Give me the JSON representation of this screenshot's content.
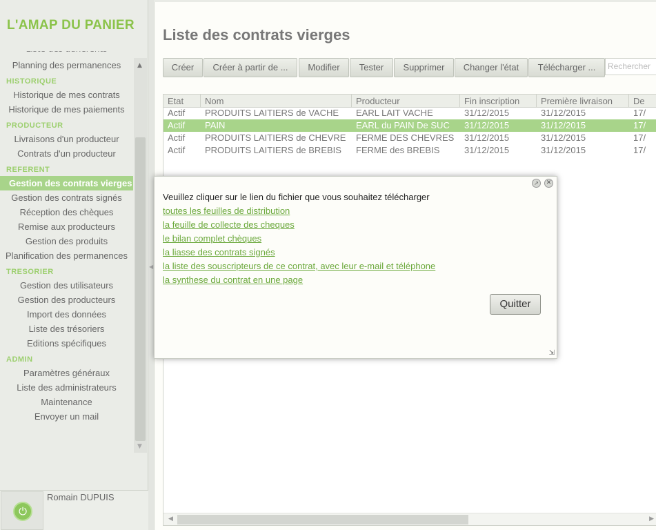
{
  "app": {
    "title": "L'AMAP DU PANIER"
  },
  "sidebar": {
    "cut_item": "Liste des adhérents",
    "sections": [
      {
        "label": "",
        "items": [
          "Planning des permanences"
        ]
      },
      {
        "label": "HISTORIQUE",
        "items": [
          "Historique de mes contrats",
          "Historique de mes paiements"
        ]
      },
      {
        "label": "PRODUCTEUR",
        "items": [
          "Livraisons d'un producteur",
          "Contrats d'un producteur"
        ]
      },
      {
        "label": "REFERENT",
        "items": [
          "Gestion des contrats vierges",
          "Gestion des contrats signés",
          "Réception des chèques",
          "Remise aux producteurs",
          "Gestion des produits",
          "Planification des permanences"
        ]
      },
      {
        "label": "TRESORIER",
        "items": [
          "Gestion des utilisateurs",
          "Gestion des producteurs",
          "Import des données",
          "Liste des trésoriers",
          "Editions spécifiques"
        ]
      },
      {
        "label": "ADMIN",
        "items": [
          "Paramètres généraux",
          "Liste des administrateurs",
          "Maintenance",
          "Envoyer un mail"
        ]
      }
    ],
    "active_item": "Gestion des contrats vierges",
    "user": {
      "name": "Romain DUPUIS",
      "power_icon": "power-icon"
    }
  },
  "main": {
    "title": "Liste des contrats vierges",
    "toolbar": {
      "create": "Créer",
      "create_from": "Créer à partir de ...",
      "modify": "Modifier",
      "test": "Tester",
      "delete": "Supprimer",
      "change_state": "Changer l'état",
      "download": "Télécharger ..."
    },
    "search_placeholder": "Rechercher",
    "grid": {
      "columns": [
        "Etat",
        "Nom",
        "Producteur",
        "Fin inscription",
        "Première livraison",
        "De"
      ],
      "rows": [
        [
          "Actif",
          "PRODUITS LAITIERS de VACHE",
          "EARL LAIT VACHE",
          "31/12/2015",
          "31/12/2015",
          "17/"
        ],
        [
          "Actif",
          "PAIN",
          "EARL du PAIN De SUC",
          "31/12/2015",
          "31/12/2015",
          "17/"
        ],
        [
          "Actif",
          "PRODUITS LAITIERS de CHEVRE",
          "FERME DES CHEVRES",
          "31/12/2015",
          "31/12/2015",
          "17/"
        ],
        [
          "Actif",
          "PRODUITS LAITIERS de BREBIS",
          "FERME des BREBIS",
          "31/12/2015",
          "31/12/2015",
          "17/"
        ]
      ],
      "selected_row": 1
    }
  },
  "dialog": {
    "message": "Veuillez cliquer sur le lien du fichier que vous souhaitez télécharger",
    "links": [
      "toutes les feuilles de distribution",
      "la feuille de collecte des cheques",
      "le bilan complet chèques",
      "la liasse des contrats signés",
      "la liste des souscripteurs de ce contrat, avec leur e-mail et téléphone",
      "la synthese du contrat en une page"
    ],
    "quit_label": "Quitter"
  },
  "colors": {
    "accent": "#8bc34a",
    "selection": "#a8d48a",
    "link": "#6aa83a"
  }
}
